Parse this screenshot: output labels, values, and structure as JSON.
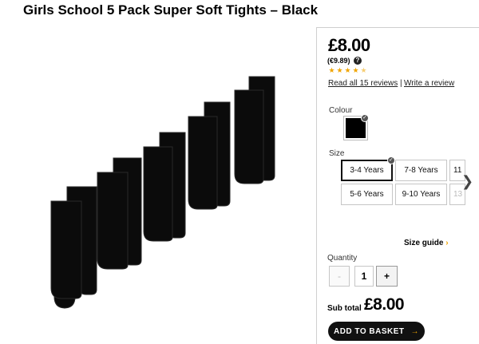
{
  "product": {
    "title": "Girls School 5 Pack Super Soft Tights – Black"
  },
  "pricing": {
    "price": "£8.00",
    "price_eur": "(€9.89)",
    "help_icon_label": "?"
  },
  "rating": {
    "value": 4.5,
    "max": 5,
    "read_reviews_label": "Read all 15 reviews",
    "separator": "|",
    "write_review_label": "Write a review"
  },
  "colour": {
    "label": "Colour",
    "selected_hex": "#000000"
  },
  "size": {
    "label": "Size",
    "options": [
      {
        "label": "3-4 Years",
        "selected": true
      },
      {
        "label": "7-8 Years",
        "selected": false
      },
      {
        "label": "11",
        "selected": false
      },
      {
        "label": "5-6 Years",
        "selected": false
      },
      {
        "label": "9-10 Years",
        "selected": false
      },
      {
        "label": "13",
        "selected": false
      }
    ],
    "size_guide_label": "Size guide",
    "arrow_glyph": "›"
  },
  "quantity": {
    "label": "Quantity",
    "minus_label": "-",
    "value": "1",
    "plus_label": "+"
  },
  "subtotal": {
    "label": "Sub total",
    "value": "£8.00"
  },
  "basket": {
    "label": "ADD TO BASKET",
    "arrow_glyph": "→"
  },
  "colors": {
    "accent": "#f0a500",
    "button": "#111111"
  }
}
